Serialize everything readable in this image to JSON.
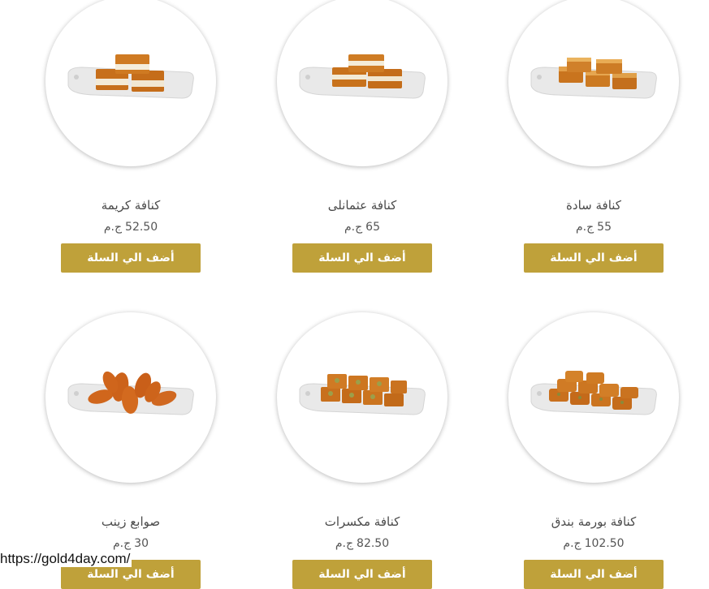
{
  "currency": "ج.م",
  "add_to_cart_label": "أضف الي السلة",
  "products": [
    {
      "name": "كنافة سادة",
      "price": "55",
      "image": "square-pieces-on-plate"
    },
    {
      "name": "كنافة عثمانلى",
      "price": "65",
      "image": "layered-cream-pieces-on-plate"
    },
    {
      "name": "كنافة كريمة",
      "price": "52.50",
      "image": "cream-pieces-on-plate"
    },
    {
      "name": "كنافة بورمة بندق",
      "price": "102.50",
      "image": "rolled-pieces-on-plate"
    },
    {
      "name": "كنافة مكسرات",
      "price": "82.50",
      "image": "nut-pieces-on-plate"
    },
    {
      "name": "صوابع زينب",
      "price": "30",
      "image": "fingers-on-plate"
    }
  ],
  "watermark": "https://gold4day.com/"
}
